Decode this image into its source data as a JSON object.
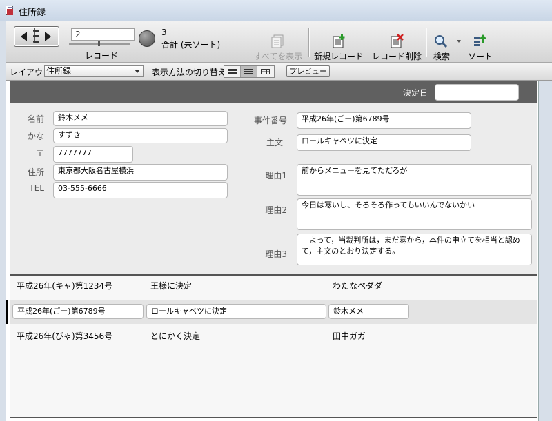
{
  "window": {
    "title": "住所録"
  },
  "toolbar": {
    "record_value": "2",
    "record_label": "レコード",
    "count_value": "3",
    "count_label": "合計 (未ソート)",
    "show_all": "すべてを表示",
    "new_record": "新規レコード",
    "delete_record": "レコード削除",
    "search": "検索",
    "sort": "ソート"
  },
  "layoutbar": {
    "layout_label": "レイアウト:",
    "layout_value": "住所録",
    "view_label": "表示方法の切り替え:",
    "preview": "プレビュー"
  },
  "header": {
    "decision_label": "決定日",
    "decision_value": ""
  },
  "form": {
    "name_label": "名前",
    "name_value": "鈴木メメ",
    "kana_label": "かな",
    "kana_value": "すずき",
    "zip_label": "〒",
    "zip_value": "7777777",
    "address_label": "住所",
    "address_value": "東京都大阪名古屋横浜",
    "tel_label": "TEL",
    "tel_value": "03-555-6666",
    "case_label": "事件番号",
    "case_value": "平成26年(ごー)第6789号",
    "main_label": "主文",
    "main_value": "ロールキャベツに決定",
    "reason1_label": "理由1",
    "reason1_value": "前からメニューを見てただろが",
    "reason2_label": "理由2",
    "reason2_value": "今日は寒いし、そろそろ作ってもいいんでないかい",
    "reason3_label": "理由3",
    "reason3_value": "　よって，当裁判所は，まだ寒から，本件の申立てを相当と認めて，主文のとおり決定する。"
  },
  "list": {
    "rows": [
      {
        "case": "平成26年(キャ)第1234号",
        "main": "王様に決定",
        "name": "わたなべダダ"
      },
      {
        "case": "平成26年(ごー)第6789号",
        "main": "ロールキャベツに決定",
        "name": "鈴木メメ"
      },
      {
        "case": "平成26年(びゃ)第3456号",
        "main": "とにかく決定",
        "name": "田中ガガ"
      }
    ]
  }
}
